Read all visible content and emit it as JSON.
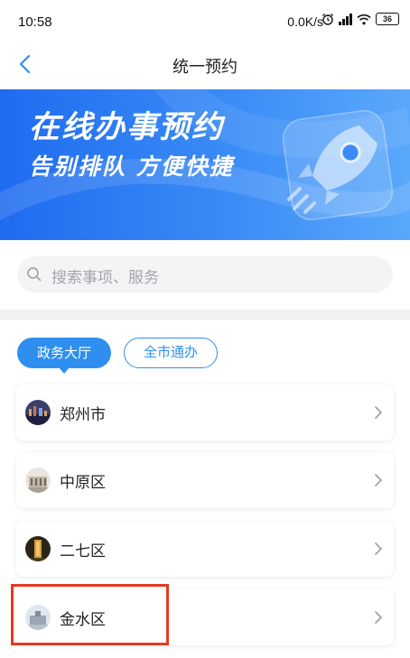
{
  "status_bar": {
    "time": "10:58",
    "network_speed": "0.0K/s",
    "battery": "36"
  },
  "nav": {
    "title": "统一预约"
  },
  "banner": {
    "title": "在线办事预约",
    "subtitle": "告别排队  方便快捷"
  },
  "search": {
    "placeholder": "搜索事项、服务"
  },
  "tabs": [
    {
      "label": "政务大厅",
      "active": true
    },
    {
      "label": "全市通办",
      "active": false
    }
  ],
  "locations": [
    {
      "label": "郑州市",
      "avatar": "city-night-photo"
    },
    {
      "label": "中原区",
      "avatar": "government-building-photo"
    },
    {
      "label": "二七区",
      "avatar": "erqi-tower-night-photo"
    },
    {
      "label": "金水区",
      "avatar": "government-building-photo"
    }
  ],
  "colors": {
    "accent": "#2f8ff0",
    "highlight": "#e53a23",
    "banner_start": "#1f6cf0",
    "banner_end": "#5aa8fb"
  }
}
